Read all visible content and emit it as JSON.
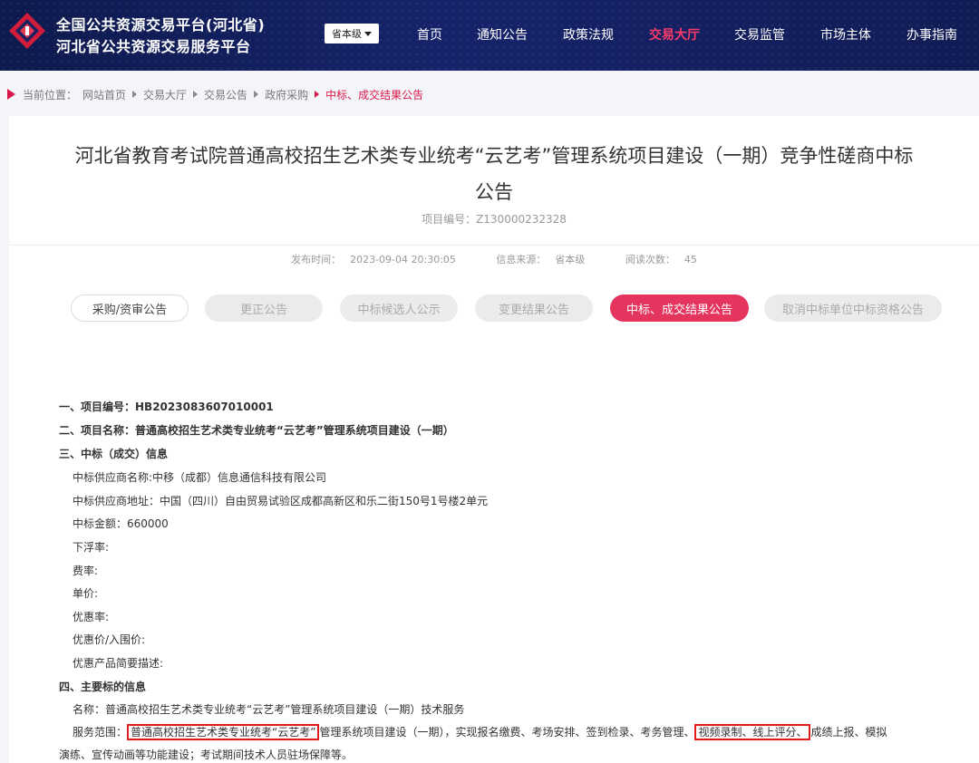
{
  "header": {
    "brand_line1": "全国公共资源交易平台(河北省)",
    "brand_line2": "河北省公共资源交易服务平台",
    "level_select": "省本级",
    "nav": [
      "首页",
      "通知公告",
      "政策法规",
      "交易大厅",
      "交易监管",
      "市场主体",
      "办事指南"
    ],
    "active_nav": "交易大厅",
    "accent": "#ff3b6b"
  },
  "breadcrumb": {
    "label": "当前位置：",
    "items": [
      "网站首页",
      "交易大厅",
      "交易公告",
      "政府采购"
    ],
    "current": "中标、成交结果公告"
  },
  "article": {
    "title_line1": "河北省教育考试院普通高校招生艺术类专业统考“云艺考”管理系统项目建设（一期）竞争性磋商中标",
    "title_line2": "公告",
    "project_no": "项目编号：Z130000232328",
    "publish_label": "发布时间：",
    "publish_time": "2023-09-04 20:30:05",
    "source_label": "信息来源：",
    "source": "省本级",
    "views_label": "阅读次数：",
    "views": "45"
  },
  "tabs": [
    {
      "label": "采购/资审公告",
      "state": "normal"
    },
    {
      "label": "更正公告",
      "state": "disabled"
    },
    {
      "label": "中标候选人公示",
      "state": "disabled"
    },
    {
      "label": "变更结果公告",
      "state": "disabled"
    },
    {
      "label": "中标、成交结果公告",
      "state": "active"
    },
    {
      "label": "取消中标单位中标资格公告",
      "state": "disabled"
    }
  ],
  "body": {
    "s1": "一、项目编号：HB2023083607010001",
    "s2": "二、项目名称：普通高校招生艺术类专业统考“云艺考”管理系统项目建设（一期）",
    "s3": "三、中标（成交）信息",
    "supplier_name": "中标供应商名称:中移（成都）信息通信科技有限公司",
    "supplier_addr": "中标供应商地址：中国（四川）自由贸易试验区成都高新区和乐二街150号1号楼2单元",
    "amount": "中标金额：660000",
    "float_rate": "下浮率:",
    "fee_rate": "费率:",
    "unit_price": "单价:",
    "discount_rate": "优惠率:",
    "discount_price": "优惠价/入围价:",
    "product_desc": "优惠产品简要描述:",
    "s4": "四、主要标的信息",
    "item_name": "名称：普通高校招生艺术类专业统考“云艺考”管理系统项目建设（一期）技术服务",
    "scope_label": "服务范围：",
    "scope_hl1": "普通高校招生艺术类专业统考“云艺考”",
    "scope_mid": "管理系统项目建设（一期），实现报名缴费、考场安排、签到检录、考务管理、",
    "scope_hl2": "视频录制、线上评分、",
    "scope_end": "成绩上报、模拟",
    "scope_line2": "演练、宣传动画等功能建设；考试期间技术人员驻场保障等。",
    "highlight_color": "#e01b1b"
  }
}
